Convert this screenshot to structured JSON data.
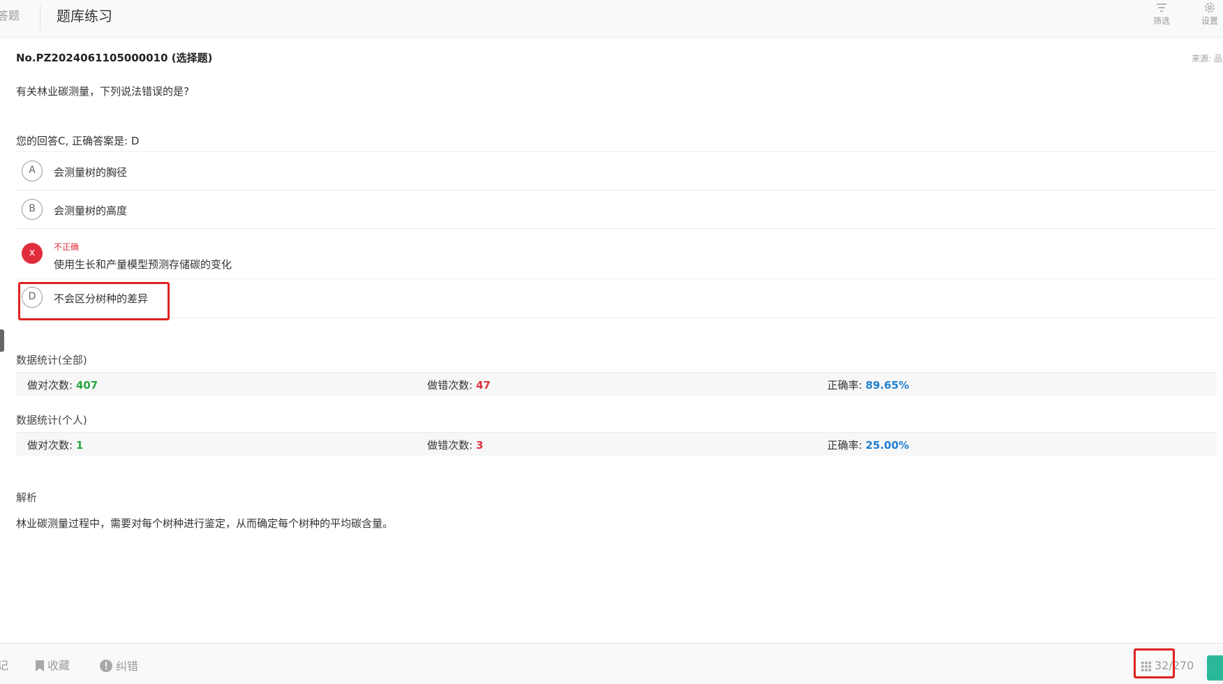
{
  "header": {
    "left_tab_label": "答题",
    "title": "题库练习",
    "filter_label": "筛选",
    "settings_label": "设置"
  },
  "question": {
    "number": "No.PZ2024061105000010 (选择题)",
    "source": "来源: 品",
    "stem": "有关林业碳测量，下列说法错误的是?",
    "answer_summary": "您的回答C, 正确答案是: D"
  },
  "options": [
    {
      "letter": "A",
      "text": "会测量树的胸径"
    },
    {
      "letter": "B",
      "text": "会测量树的高度"
    },
    {
      "letter": "x",
      "status": "不正确",
      "text": "使用生长和产量模型预测存储碳的变化"
    },
    {
      "letter": "D",
      "text": "不会区分树种的差异"
    }
  ],
  "stats": {
    "all": {
      "title": "数据统计(全部)",
      "correct_label": "做对次数: ",
      "correct_value": "407",
      "wrong_label": "做错次数: ",
      "wrong_value": "47",
      "rate_label": "正确率: ",
      "rate_value": "89.65%"
    },
    "personal": {
      "title": "数据统计(个人)",
      "correct_label": "做对次数: ",
      "correct_value": "1",
      "wrong_label": "做错次数: ",
      "wrong_value": "3",
      "rate_label": "正确率: ",
      "rate_value": "25.00%"
    }
  },
  "analysis": {
    "title": "解析",
    "text": "林业碳测量过程中，需要对每个树种进行鉴定，从而确定每个树种的平均碳含量。"
  },
  "footer": {
    "note_label": "记",
    "favorite_label": "收藏",
    "report_label": "纠错",
    "progress": "32/270"
  },
  "colors": {
    "wrong": "#e02d3c",
    "correct_value": "#2aa541",
    "rate_value": "#1f7fd0",
    "highlight_box": "#e02020",
    "next_button": "#2bb89a"
  },
  "icons": {
    "filter": "filter-icon",
    "settings": "gear-icon",
    "favorite": "bookmark-icon",
    "report": "exclamation-circle-icon",
    "progress": "grid-icon"
  }
}
